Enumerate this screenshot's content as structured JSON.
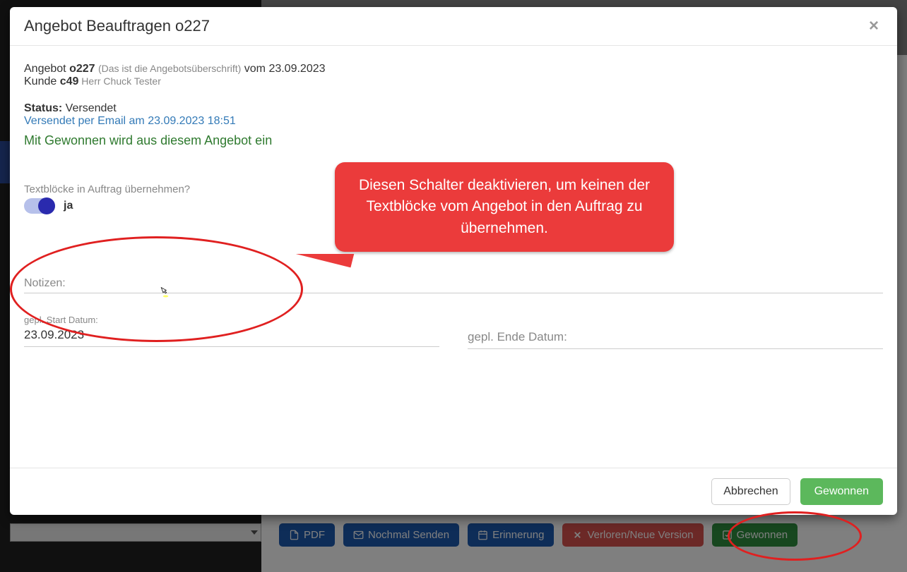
{
  "modal": {
    "title": "Angebot Beauftragen o227",
    "offer_prefix": "Angebot ",
    "offer_id": "o227",
    "offer_subtitle": "(Das ist die Angebotsüberschrift)",
    "offer_date_prefix": " vom ",
    "offer_date": "23.09.2023",
    "customer_prefix": "Kunde ",
    "customer_id": "c49",
    "customer_name": " Herr Chuck Tester",
    "status_label": "Status:",
    "status_value": " Versendet",
    "sent_text": "Versendet per Email am 23.09.2023 18:51",
    "win_message": "Mit Gewonnen wird aus diesem Angebot ein",
    "toggle_label": "Textblöcke in Auftrag übernehmen?",
    "toggle_value": "ja",
    "notes_placeholder": "Notizen:",
    "start_label": "gepl. Start Datum:",
    "start_value": "23.09.2023",
    "end_placeholder": "gepl. Ende Datum:",
    "cancel": "Abbrechen",
    "confirm": "Gewonnen"
  },
  "callout": {
    "text": "Diesen Schalter deaktivieren, um keinen der Textblöcke vom Angebot in den Auftrag zu übernehmen."
  },
  "toolbar": {
    "pdf": "PDF",
    "resend": "Nochmal Senden",
    "reminder": "Erinnerung",
    "lost": "Verloren/Neue Version",
    "won": "Gewonnen"
  }
}
